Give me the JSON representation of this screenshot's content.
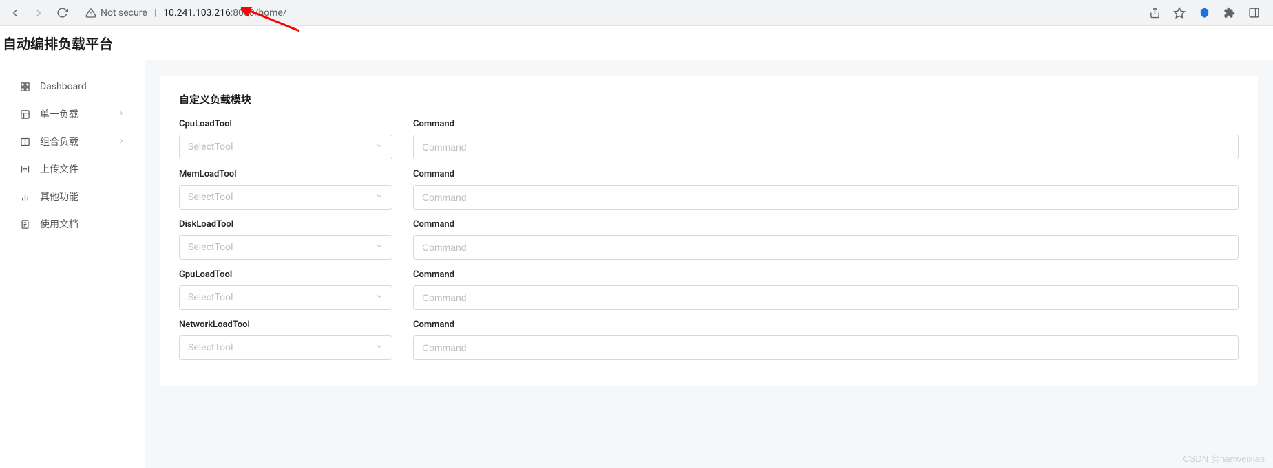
{
  "browser": {
    "not_secure_label": "Not secure",
    "url_host": "10.241.103.216",
    "url_path": ":8000/home/"
  },
  "header": {
    "title": "自动编排负载平台"
  },
  "sidebar": {
    "items": [
      {
        "label": "Dashboard",
        "icon": "grid-icon",
        "expandable": false
      },
      {
        "label": "单一负载",
        "icon": "layout-icon",
        "expandable": true
      },
      {
        "label": "组合负载",
        "icon": "columns-icon",
        "expandable": true
      },
      {
        "label": "上传文件",
        "icon": "upload-icon",
        "expandable": false
      },
      {
        "label": "其他功能",
        "icon": "chart-icon",
        "expandable": false
      },
      {
        "label": "使用文档",
        "icon": "document-icon",
        "expandable": false
      }
    ]
  },
  "card": {
    "title": "自定义负载模块",
    "rows": [
      {
        "tool_label": "CpuLoadTool",
        "command_label": "Command",
        "select_placeholder": "SelectTool",
        "command_placeholder": "Command"
      },
      {
        "tool_label": "MemLoadTool",
        "command_label": "Command",
        "select_placeholder": "SelectTool",
        "command_placeholder": "Command"
      },
      {
        "tool_label": "DiskLoadTool",
        "command_label": "Command",
        "select_placeholder": "SelectTool",
        "command_placeholder": "Command"
      },
      {
        "tool_label": "GpuLoadTool",
        "command_label": "Command",
        "select_placeholder": "SelectTool",
        "command_placeholder": "Command"
      },
      {
        "tool_label": "NetworkLoadTool",
        "command_label": "Command",
        "select_placeholder": "SelectTool",
        "command_placeholder": "Command"
      }
    ]
  },
  "watermark": "CSDN @hanweixiao"
}
